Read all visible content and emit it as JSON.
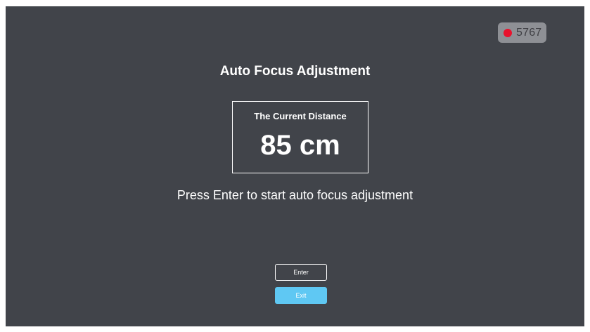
{
  "recording": {
    "count": "5767",
    "dot_color": "#e8122d"
  },
  "dialog": {
    "title": "Auto Focus Adjustment",
    "distance_label": "The Current Distance",
    "distance_value": "85 cm",
    "instruction": "Press Enter to start auto focus adjustment"
  },
  "buttons": {
    "enter_label": "Enter",
    "exit_label": "Exit"
  },
  "colors": {
    "background": "#41444a",
    "exit_button": "#5fc8f3"
  }
}
